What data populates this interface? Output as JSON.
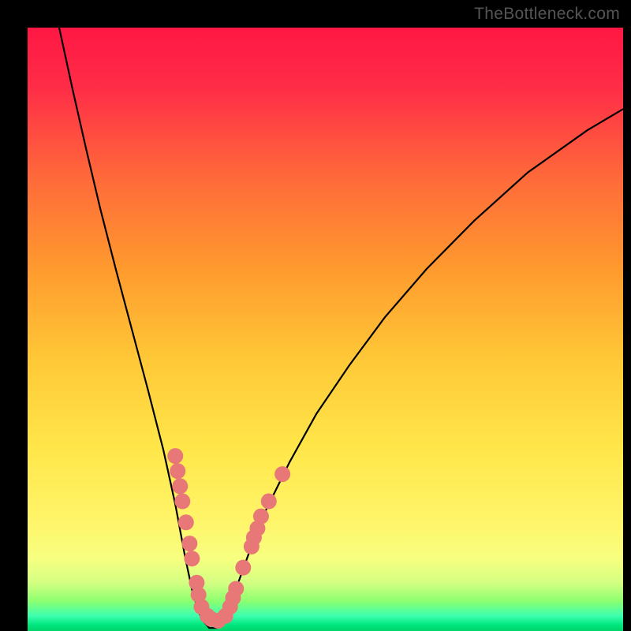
{
  "watermark": "TheBottleneck.com",
  "chart_data": {
    "type": "line",
    "title": "",
    "xlabel": "",
    "ylabel": "",
    "xlim": [
      0,
      100
    ],
    "ylim": [
      0,
      100
    ],
    "gradient_stops": [
      {
        "offset": 0,
        "color": "#ff1744"
      },
      {
        "offset": 10,
        "color": "#ff2d47"
      },
      {
        "offset": 25,
        "color": "#ff6a3a"
      },
      {
        "offset": 40,
        "color": "#ff9a2e"
      },
      {
        "offset": 55,
        "color": "#ffc837"
      },
      {
        "offset": 70,
        "color": "#ffe74a"
      },
      {
        "offset": 82,
        "color": "#fff56a"
      },
      {
        "offset": 88,
        "color": "#f7ff80"
      },
      {
        "offset": 92,
        "color": "#d4ff82"
      },
      {
        "offset": 95,
        "color": "#8dff6f"
      },
      {
        "offset": 97.5,
        "color": "#3dffb0"
      },
      {
        "offset": 99,
        "color": "#00e67d"
      },
      {
        "offset": 100,
        "color": "#00d46b"
      }
    ],
    "series": [
      {
        "name": "bottleneck-curve",
        "stroke": "#000000",
        "points": [
          {
            "x": 5.3,
            "y": 100
          },
          {
            "x": 7.5,
            "y": 90
          },
          {
            "x": 9.8,
            "y": 80
          },
          {
            "x": 12.2,
            "y": 70
          },
          {
            "x": 14.8,
            "y": 60
          },
          {
            "x": 17.5,
            "y": 50
          },
          {
            "x": 20.2,
            "y": 40
          },
          {
            "x": 22.8,
            "y": 30
          },
          {
            "x": 24.8,
            "y": 21
          },
          {
            "x": 26.5,
            "y": 12
          },
          {
            "x": 27.8,
            "y": 6
          },
          {
            "x": 29.2,
            "y": 2
          },
          {
            "x": 30.5,
            "y": 0.5
          },
          {
            "x": 31.8,
            "y": 0.5
          },
          {
            "x": 33.0,
            "y": 2
          },
          {
            "x": 35.0,
            "y": 7
          },
          {
            "x": 37.2,
            "y": 13
          },
          {
            "x": 40.0,
            "y": 20
          },
          {
            "x": 44.0,
            "y": 28
          },
          {
            "x": 48.5,
            "y": 36
          },
          {
            "x": 54.0,
            "y": 44
          },
          {
            "x": 60.0,
            "y": 52
          },
          {
            "x": 67.0,
            "y": 60
          },
          {
            "x": 75.0,
            "y": 68
          },
          {
            "x": 84.0,
            "y": 76
          },
          {
            "x": 94.0,
            "y": 83
          },
          {
            "x": 100,
            "y": 86.5
          }
        ]
      }
    ],
    "scatter_points": {
      "color": "#e87878",
      "radius": 10,
      "points": [
        {
          "x": 24.8,
          "y": 29
        },
        {
          "x": 25.2,
          "y": 26.5
        },
        {
          "x": 25.6,
          "y": 24
        },
        {
          "x": 26.0,
          "y": 21.5
        },
        {
          "x": 26.6,
          "y": 18
        },
        {
          "x": 27.2,
          "y": 14.5
        },
        {
          "x": 27.6,
          "y": 12
        },
        {
          "x": 28.4,
          "y": 8
        },
        {
          "x": 28.7,
          "y": 6
        },
        {
          "x": 29.2,
          "y": 4
        },
        {
          "x": 30.2,
          "y": 2.5
        },
        {
          "x": 30.8,
          "y": 2
        },
        {
          "x": 32.0,
          "y": 1.7
        },
        {
          "x": 33.2,
          "y": 2.5
        },
        {
          "x": 34.0,
          "y": 4
        },
        {
          "x": 34.5,
          "y": 5.5
        },
        {
          "x": 35.0,
          "y": 7
        },
        {
          "x": 36.2,
          "y": 10.5
        },
        {
          "x": 37.6,
          "y": 14
        },
        {
          "x": 38.0,
          "y": 15.5
        },
        {
          "x": 38.6,
          "y": 17
        },
        {
          "x": 39.2,
          "y": 19
        },
        {
          "x": 40.5,
          "y": 21.5
        },
        {
          "x": 42.8,
          "y": 26
        }
      ]
    }
  }
}
